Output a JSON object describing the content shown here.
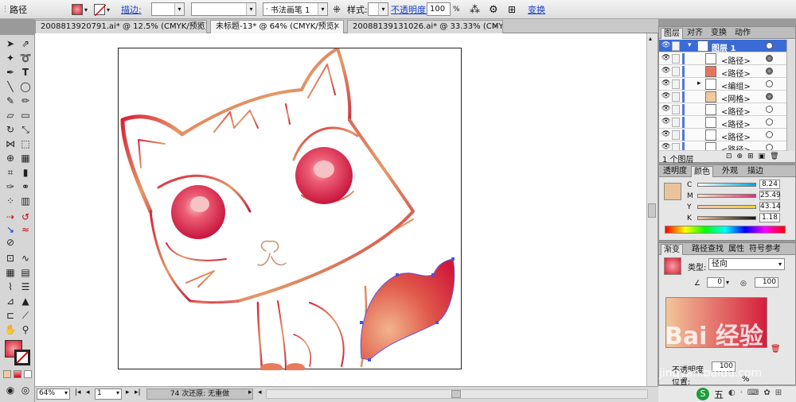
{
  "control_bar": {
    "selection_label": "路径",
    "stroke_label": "描边:",
    "brush_name": "书法画笔 1",
    "style_label": "样式:",
    "opacity_label": "不透明度:",
    "opacity_value": "100",
    "opacity_unit": "%",
    "transform_label": "变换"
  },
  "tabs": [
    {
      "label": "2008813920791.ai* @ 12.5% (CMYK/预览)"
    },
    {
      "label": "未标题-13* @ 64% (CMYK/预览)"
    },
    {
      "label": "20088139131026.ai* @ 33.33% (CMYK/预览)"
    }
  ],
  "status_bar": {
    "zoom": "64%",
    "page": "1",
    "status_text": "74 次还原: 无重做"
  },
  "layers_panel": {
    "tabs": [
      "图层",
      "对齐",
      "变换",
      "动作"
    ],
    "rows": [
      {
        "name": "图层 1"
      },
      {
        "name": "<路径>"
      },
      {
        "name": "<路径>"
      },
      {
        "name": "<编组>"
      },
      {
        "name": "<网格>"
      },
      {
        "name": "<路径>"
      },
      {
        "name": "<路径>"
      },
      {
        "name": "<路径>"
      },
      {
        "name": "<路径>"
      }
    ],
    "footer": "1 个图层"
  },
  "color_panel": {
    "tabs": [
      "透明度",
      "颜色",
      "外观",
      "描边"
    ],
    "channels": [
      {
        "label": "C",
        "value": "8.24",
        "level": 0.08
      },
      {
        "label": "M",
        "value": "25.49",
        "level": 0.25
      },
      {
        "label": "Y",
        "value": "43.14",
        "level": 0.43
      },
      {
        "label": "K",
        "value": "1.18",
        "level": 0.01
      }
    ]
  },
  "gradient_panel": {
    "tabs": [
      "渐变",
      "路径查找",
      "属性",
      "符号参考"
    ],
    "type_label": "类型:",
    "type_value": "径向",
    "angle_value": "0",
    "aspect_value": "100",
    "opacity_label": "不透明度:",
    "opacity_value": "100",
    "location_label": "位置:",
    "location_unit": "%"
  },
  "watermark": {
    "text": "Bai 经验",
    "url": "jingyan.baidu.com"
  },
  "taskbar": {
    "ime": "五"
  }
}
